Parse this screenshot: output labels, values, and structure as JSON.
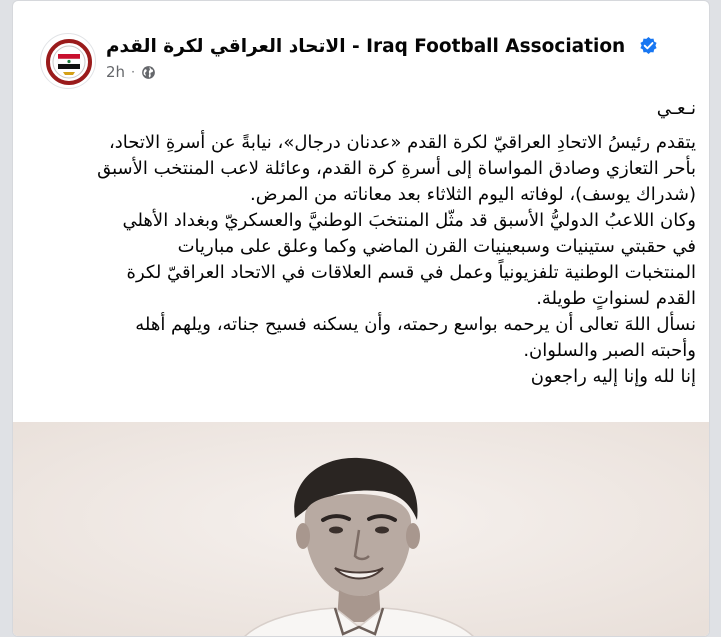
{
  "post": {
    "page_name": "الاتحاد العراقي لكرة القدم - Iraq Football Association",
    "timestamp": "2h",
    "privacy_icon": "globe-icon",
    "verified_icon": "verified-badge-icon",
    "lines": [
      "نـعـي",
      "يتقدم رئيسُ الاتحادِ العراقيّ لكرة القدم «عدنان درجال»، نيابةً عن أسرةِ الاتحاد،",
      "بأحر التعازي وصادق المواساة إلى أسرةِ كرة القدم، وعائلة لاعب المنتخب الأسبق",
      "(شدراك يوسف)، لوفاته اليوم الثلاثاء بعد معاناته من المرض.",
      "وكان اللاعبُ الدوليُّ الأسبق قد مثّل المنتخبَ الوطنيَّ والعسكريّ وبغداد الأهلي",
      "في حقبتي ستينيات وسبعينيات القرن الماضي وكما وعلق على مباريات",
      "المنتخبات الوطنية تلفزيونياً وعمل في قسم العلاقات في الاتحاد العراقيّ لكرة",
      "القدم لسنواتٍ طويلة.",
      "نسأل اللهَ تعالى أن يرحمه بواسع رحمته، وأن يسكنه فسيح جناته، ويلهم أهله",
      "وأحبته الصبر والسلوان.",
      "إنا لله وإنا إليه راجعون"
    ]
  },
  "colors": {
    "card_bg": "#ffffff",
    "page_bg": "#dfe1e5",
    "text": "#050505",
    "meta": "#65676b",
    "verified": "#1877f2",
    "photo_bg": "#f2ece8"
  }
}
